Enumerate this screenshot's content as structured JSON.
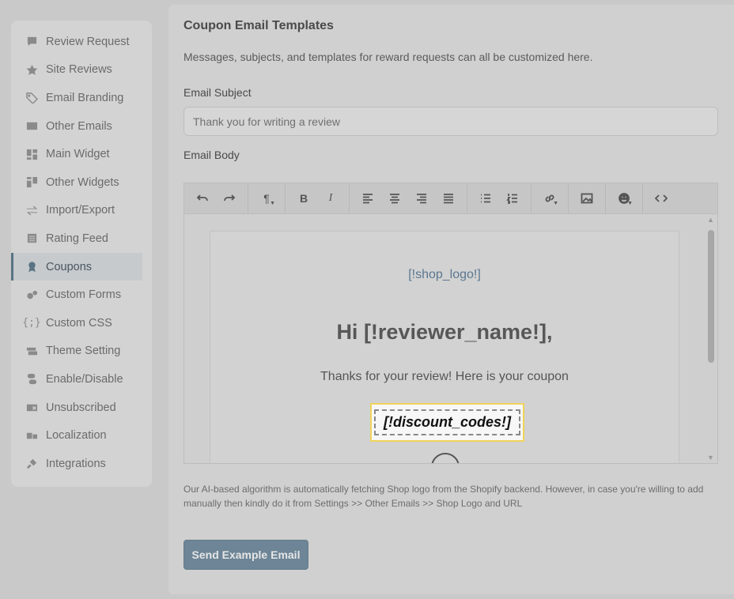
{
  "sidebar": {
    "items": [
      {
        "label": "Review Request",
        "icon": "comment-alert-icon"
      },
      {
        "label": "Site Reviews",
        "icon": "star-icon"
      },
      {
        "label": "Email Branding",
        "icon": "tag-icon"
      },
      {
        "label": "Other Emails",
        "icon": "envelope-icon"
      },
      {
        "label": "Main Widget",
        "icon": "widget-icon"
      },
      {
        "label": "Other Widgets",
        "icon": "widgets-icon"
      },
      {
        "label": "Import/Export",
        "icon": "swap-icon"
      },
      {
        "label": "Rating Feed",
        "icon": "list-icon"
      },
      {
        "label": "Coupons",
        "icon": "badge-icon",
        "active": true
      },
      {
        "label": "Custom Forms",
        "icon": "gears-icon"
      },
      {
        "label": "Custom CSS",
        "icon": "code-braces-icon"
      },
      {
        "label": "Theme Setting",
        "icon": "palette-icon"
      },
      {
        "label": "Enable/Disable",
        "icon": "toggle-icon"
      },
      {
        "label": "Unsubscribed",
        "icon": "mail-x-icon"
      },
      {
        "label": "Localization",
        "icon": "language-icon"
      },
      {
        "label": "Integrations",
        "icon": "plug-icon"
      }
    ]
  },
  "main": {
    "title": "Coupon Email Templates",
    "description": "Messages, subjects, and templates for reward requests can all be customized here.",
    "subject_label": "Email Subject",
    "subject_value": "Thank you for writing a review",
    "body_label": "Email Body",
    "editor": {
      "toolbar": {
        "paragraph_glyph": "¶",
        "bold_glyph": "B",
        "italic_glyph": "I"
      },
      "shop_logo": "[!shop_logo!]",
      "greeting": "Hi [!reviewer_name!],",
      "thanks": "Thanks for your review! Here is your coupon",
      "discount": "[!discount_codes!]"
    },
    "note": "Our AI-based algorithm is automatically fetching Shop logo from the Shopify backend. However, in case you're willing to add manually then kindly do it from Settings >> Other Emails >> Shop Logo and URL",
    "send_button": "Send Example Email"
  },
  "colors": {
    "accent": "#5a7384",
    "button": "#6d8596",
    "highlight_border": "#f0d35a"
  }
}
